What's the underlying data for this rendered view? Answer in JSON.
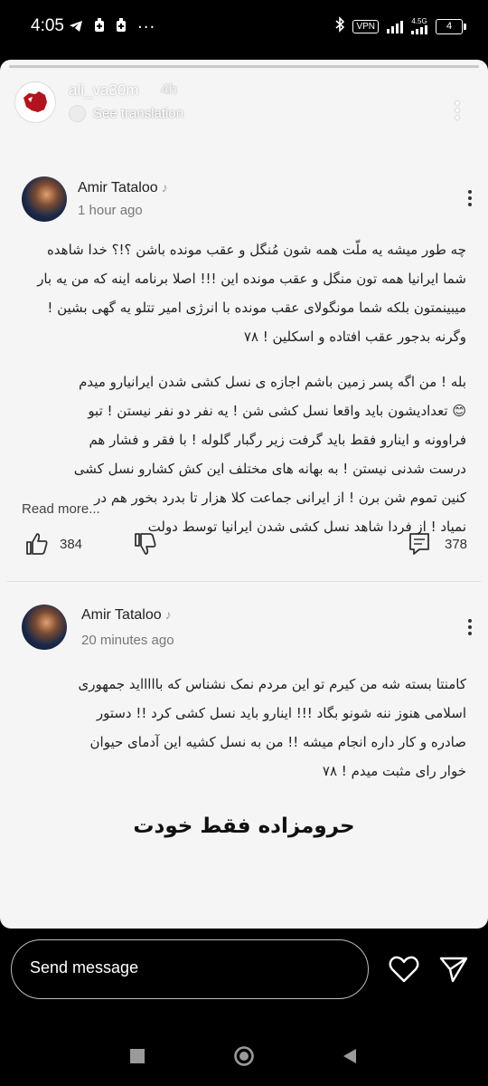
{
  "status_bar": {
    "time": "4:05",
    "network_label": "4.5G",
    "vpn_label": "VPN",
    "battery": "4"
  },
  "story": {
    "username": "ali_va30m",
    "time_ago": "4h",
    "see_translation": "See translation"
  },
  "comments": [
    {
      "author": "Amir Tataloo",
      "time": "1 hour ago",
      "lines": [
        "چه طور میشه یه ملّت همه شون مُنگل و عقب مونده باشن ؟!؟ خدا شاهده",
        "شما ایرانیا همه تون منگل و عقب مونده این !!! اصلا برنامه اینه که من یه بار",
        "میبینمتون بلکه شما مونگولای عقب مونده با انرژی امیر تتلو یه گهی بشین !",
        "وگرنه بدجور عقب افتاده و اسکلین ! ۷۸",
        "",
        "بله ! من اگه پسر زمین باشم اجازه ی نسل کشی شدن ایرانیارو میدم",
        "😊 تعدادیشون باید واقعا نسل کشی شن ! یه نفر دو نفر نیستن ! تبو",
        "فراوونه و اینارو فقط باید گرفت زیر رگبار گلوله ! با فقر و فشار هم",
        "درست شدنی نیستن ! به بهانه های مختلف این کش کشارو نسل کشی",
        "کنین تموم شن برن ! از ایرانی جماعت کلا هزار تا بدرد بخور هم در",
        "نمیاد ! از فردا شاهد نسل کشی شدن ایرانیا توسط دولت"
      ],
      "read_more": "Read more...",
      "likes": "384",
      "replies": "378"
    },
    {
      "author": "Amir Tataloo",
      "time": "20 minutes ago",
      "lines": [
        "کامنتا بسته شه من کیرم تو این مردم نمک نشناس که باااااید جمهوری",
        "اسلامی هنوز ننه شونو بگاد !!! اینارو باید نسل کشی کرد !! دستور",
        "صادره و کار داره انجام میشه !! من به نسل کشیه این آدمای حیوان",
        "خوار رای مثبت میدم ! ۷۸"
      ]
    }
  ],
  "caption": "حرومزاده فقط خودت",
  "reply": {
    "placeholder": "Send message"
  },
  "colors": {
    "background": "#000000",
    "story_background": "#f5f5f5",
    "text": "#222222"
  }
}
